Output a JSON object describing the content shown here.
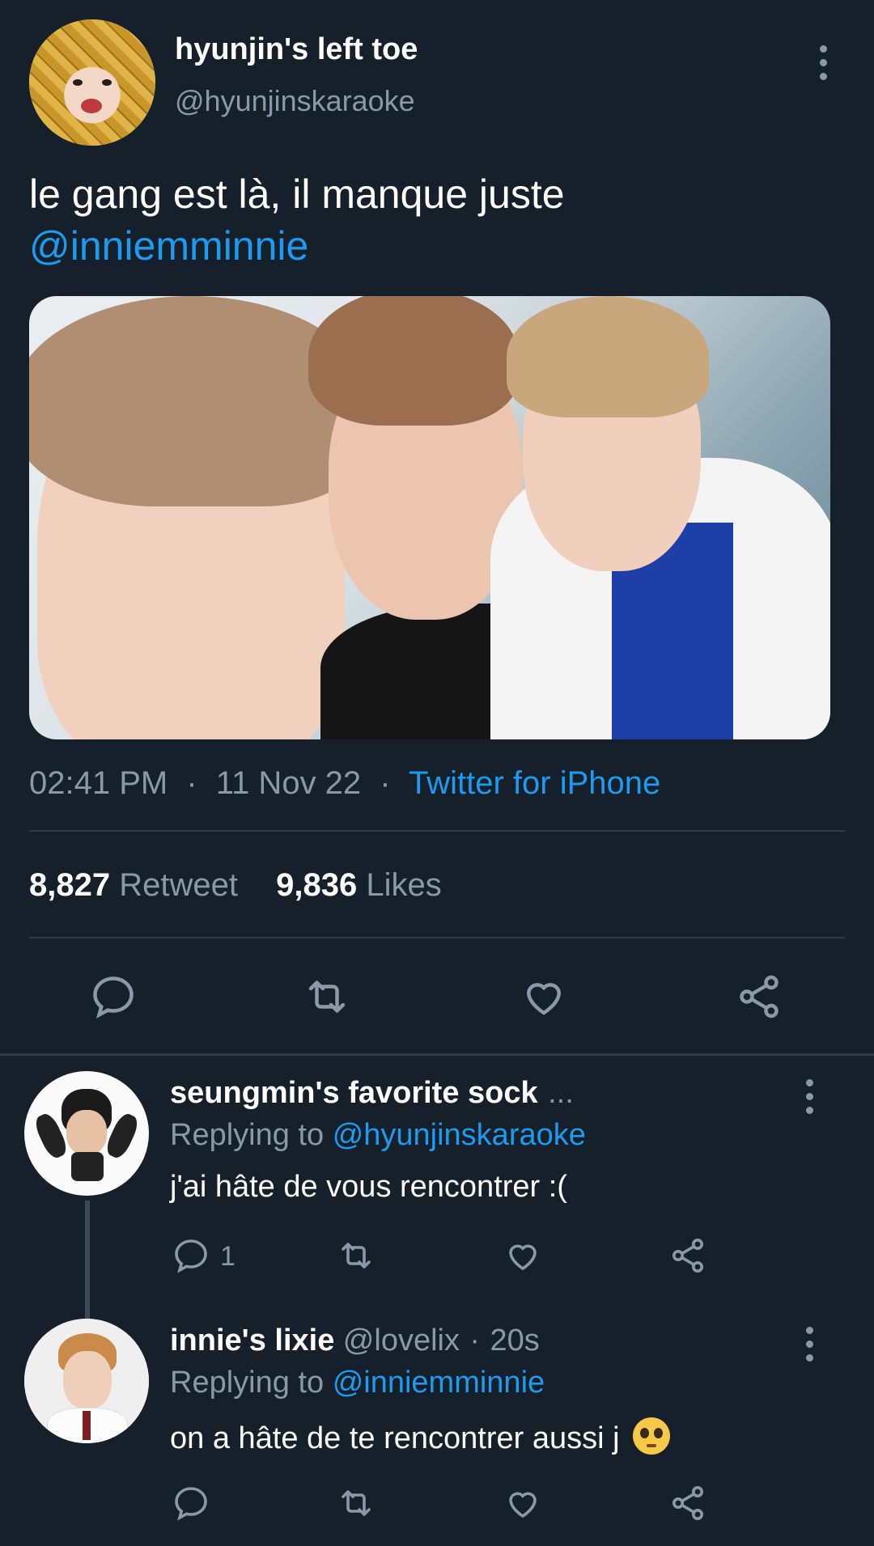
{
  "tweet": {
    "display_name": "hyunjin's left toe",
    "handle": "@hyunjinskaraoke",
    "text_line1": "le gang est là, il manque juste",
    "mention": "@inniemminnie",
    "time": "02:41 PM",
    "sep1": "·",
    "date": "11 Nov 22",
    "sep2": "·",
    "source": "Twitter for iPhone",
    "retweet_count": "8,827",
    "retweet_label": "Retweet",
    "likes_count": "9,836",
    "likes_label": "Likes",
    "avatar_icon": "pineapple-avatar"
  },
  "replies": [
    {
      "display_name": "seungmin's favorite sock",
      "ellipsis": "...",
      "replying_prefix": "Replying to",
      "replying_handle": "@hyunjinskaraoke",
      "text": "j'ai hâte de vous rencontrer :(",
      "reply_count": "1"
    },
    {
      "display_name": "innie's lixie",
      "handle": "@lovelix",
      "sep": "·",
      "time": "20s",
      "replying_prefix": "Replying to",
      "replying_handle": "@inniemminnie",
      "text": "on a hâte de te rencontrer aussi j",
      "emoji": "🥺"
    }
  ],
  "colors": {
    "background": "#15202b",
    "accent": "#1d9bf0",
    "muted": "#8b98a5",
    "divider": "#2f3b47"
  }
}
